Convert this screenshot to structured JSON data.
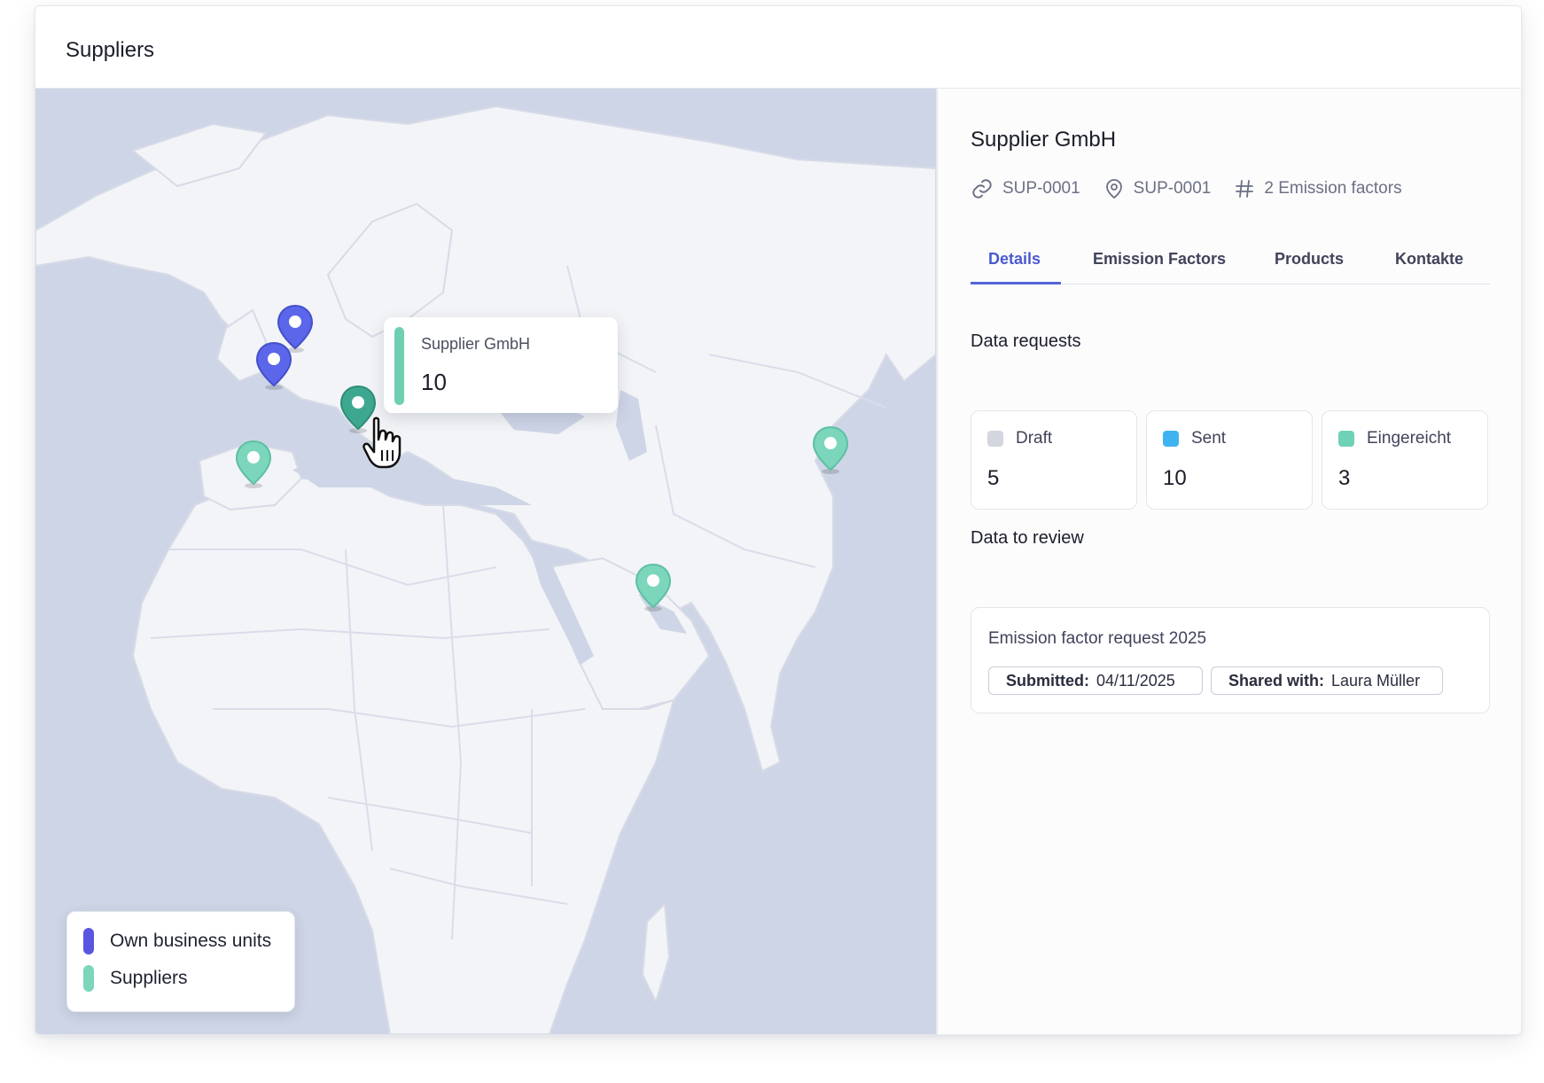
{
  "header": {
    "title": "Suppliers"
  },
  "map": {
    "tooltip": {
      "name": "Supplier GmbH",
      "value": "10",
      "accent": "#6fcfb3"
    },
    "legend": [
      {
        "label": "Own business units",
        "color": "#5a55e0"
      },
      {
        "label": "Suppliers",
        "color": "#7bd6bb"
      }
    ],
    "colors": {
      "land": "#f3f4f7",
      "sea": "#ced5e6",
      "own_pin": "#5b66ea",
      "supplier_pin": "#7bd6bb",
      "selected_pin": "#3ea790"
    }
  },
  "detail": {
    "title": "Supplier GmbH",
    "meta": [
      {
        "icon": "link-icon",
        "text": "SUP-0001"
      },
      {
        "icon": "location-pin-icon",
        "text": "SUP-0001"
      },
      {
        "icon": "hash-icon",
        "text": "2 Emission factors"
      }
    ],
    "tabs": [
      {
        "label": "Details",
        "active": true
      },
      {
        "label": "Emission Factors"
      },
      {
        "label": "Products"
      },
      {
        "label": "Kontakte"
      }
    ],
    "data_requests": {
      "title": "Data requests",
      "stats": [
        {
          "label": "Draft",
          "value": "5",
          "color": "#d3d5df"
        },
        {
          "label": "Sent",
          "value": "10",
          "color": "#3fb3ef"
        },
        {
          "label": "Eingereicht",
          "value": "3",
          "color": "#6fd1b5"
        }
      ]
    },
    "review": {
      "title": "Data to review",
      "item_title": "Emission factor request 2025",
      "submitted_label": "Submitted:",
      "submitted_value": "04/11/2025",
      "shared_label": "Shared with:",
      "shared_value": "Laura Müller"
    }
  }
}
